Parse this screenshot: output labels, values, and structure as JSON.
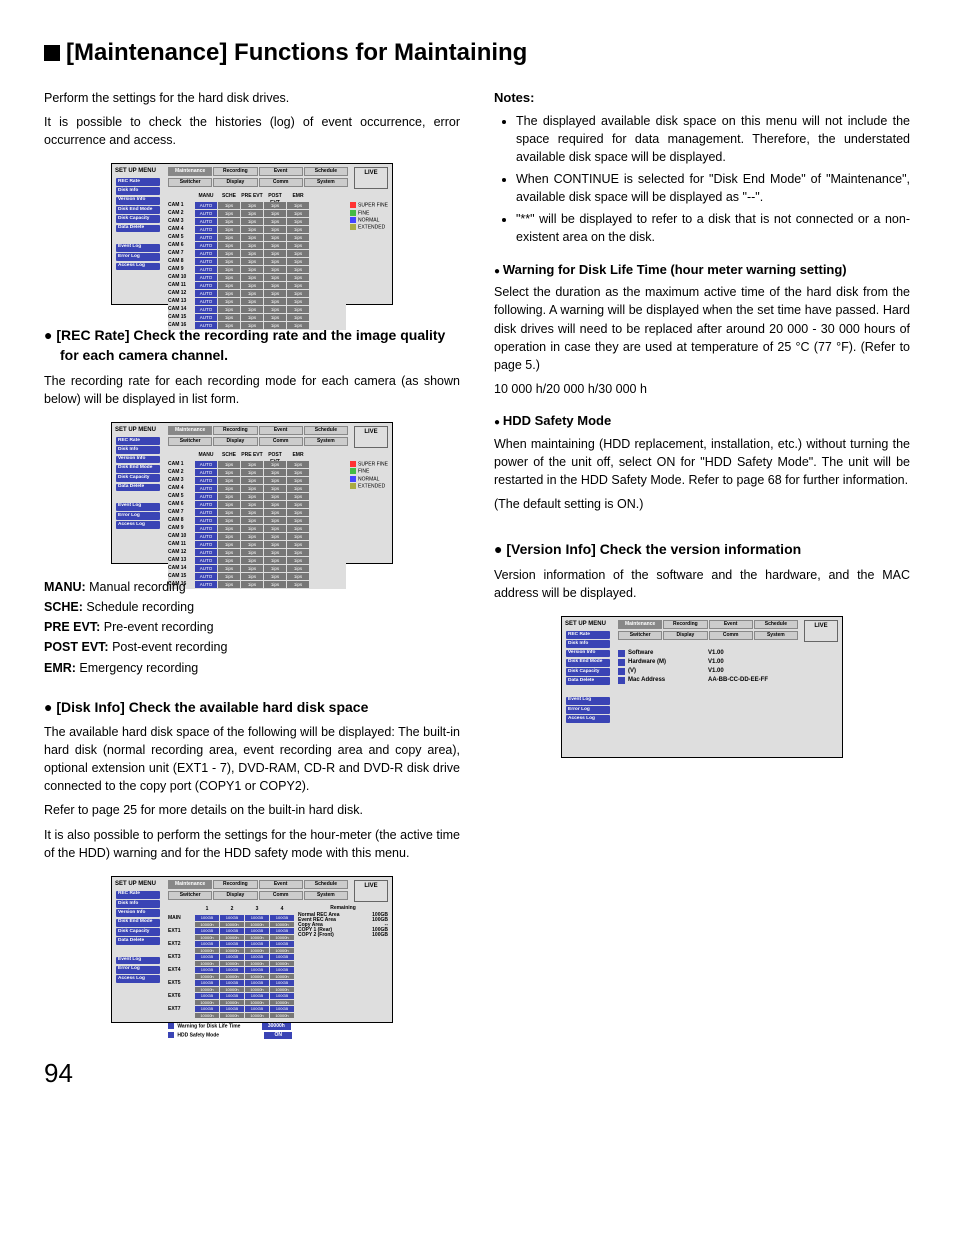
{
  "title_bracket": "[Maintenance]",
  "title_rest": " Functions for Maintaining",
  "intro_1": "Perform the settings for the hard disk drives.",
  "intro_2": "It is possible to check the histories (log) of event occurrence, error occurrence and access.",
  "rec_rate_h": "[REC Rate] Check the recording rate and the image quality for each camera channel.",
  "rec_rate_p": "The recording rate for each recording mode for each camera (as shown below) will be displayed in list form.",
  "defs": {
    "manu_l": "MANU:",
    "manu_v": " Manual recording",
    "sche_l": "SCHE:",
    "sche_v": " Schedule recording",
    "pre_l": "PRE EVT:",
    "pre_v": " Pre-event recording",
    "post_l": "POST EVT:",
    "post_v": " Post-event recording",
    "emr_l": "EMR:",
    "emr_v": " Emergency recording"
  },
  "disk_info_h": "[Disk Info] Check the available hard disk space",
  "disk_info_p1": "The available hard disk space of the following will be displayed: The built-in hard disk (normal recording area, event recording area and copy area), optional extension unit (EXT1 - 7), DVD-RAM, CD-R and DVD-R disk drive connected to the copy port (COPY1 or COPY2).",
  "disk_info_p2": "Refer to page 25 for more details on the built-in hard disk.",
  "disk_info_p3": "It is also possible to perform the settings for the hour-meter (the active time of the HDD) warning and for the HDD safety mode with this menu.",
  "notes_h": "Notes:",
  "notes": [
    "The displayed available disk space on this menu will not include the space required for data management. Therefore, the understated available disk space will be displayed.",
    "When CONTINUE is selected for \"Disk End Mode\" of \"Maintenance\", available disk space will be displayed as \"--\".",
    "\"**\" will be displayed to refer to a disk that is not connected or a non-existent area on the disk."
  ],
  "warn_h": "Warning for Disk Life Time (hour meter warning setting)",
  "warn_p1": "Select the duration as the maximum active time of the hard disk from the following. A warning will be displayed when the set time have passed. Hard disk drives will need to be replaced after around 20 000 - 30 000 hours of operation in case they are used at temperature of 25 °C (77 °F). (Refer to page 5.)",
  "warn_p2": "10 000 h/20 000 h/30 000 h",
  "hdd_h": "HDD Safety Mode",
  "hdd_p1": "When maintaining (HDD replacement, installation, etc.) without turning the power of the unit off, select ON for \"HDD Safety Mode\". The unit will be restarted in the HDD Safety Mode. Refer to page 68 for further information.",
  "hdd_p2": "(The default setting is ON.)",
  "ver_h": "[Version Info] Check the version information",
  "ver_p": "Version information of the software and the hardware, and the MAC address will be displayed.",
  "page_number": "94",
  "shots": {
    "sidebar_title": "SET UP MENU",
    "sidebar_items": [
      "REC Rate",
      "Disk Info",
      "Version Info",
      "Disk End Mode",
      "Disk Capacity",
      "Data Delete",
      "Event Log",
      "Error Log",
      "Access Log"
    ],
    "tabs_top": [
      "Maintenance",
      "Recording",
      "Event",
      "Schedule"
    ],
    "tabs_bottom": [
      "Switcher",
      "Display",
      "Comm",
      "System"
    ],
    "live": "LIVE",
    "rate_cols": [
      "MANU",
      "SCHE",
      "PRE EVT",
      "POST EVT",
      "EMR"
    ],
    "rate_rows": [
      "CAM 1",
      "CAM 2",
      "CAM 3",
      "CAM 4",
      "CAM 5",
      "CAM 6",
      "CAM 7",
      "CAM 8",
      "CAM 9",
      "CAM 10",
      "CAM 11",
      "CAM 12",
      "CAM 13",
      "CAM 14",
      "CAM 15",
      "CAM 16"
    ],
    "rate_val": "AUTO",
    "rate_ips": "1ips",
    "quality": [
      "SUPER FINE",
      "FINE",
      "NORMAL",
      "EXTENDED"
    ],
    "diskinfo_rows": [
      "MAIN",
      "EXT1",
      "EXT2",
      "EXT3",
      "EXT4",
      "EXT5",
      "EXT6",
      "EXT7"
    ],
    "diskinfo_cols": [
      "1",
      "2",
      "3",
      "4"
    ],
    "diskinfo_gb": "100GB",
    "diskinfo_h": "10000h",
    "remaining_h": "Remaining",
    "remaining": [
      {
        "k": "Normal REC Area",
        "v": "100GB"
      },
      {
        "k": "Event REC Area",
        "v": "100GB"
      },
      {
        "k": "Copy Area",
        "v": "--"
      },
      {
        "k": "COPY 1 (Rear)",
        "v": "100GB"
      },
      {
        "k": "COPY 2 (Front)",
        "v": "100GB"
      }
    ],
    "warn_life": "Warning for Disk Life Time",
    "warn_life_v": "30000h",
    "hdd_safety": "HDD Safety Mode",
    "hdd_safety_v": "ON",
    "ver_rows": [
      {
        "k": "Software",
        "v": "V1.00"
      },
      {
        "k": "Hardware (M)",
        "v": "V1.00"
      },
      {
        "k": "(V)",
        "v": "V1.00"
      },
      {
        "k": "Mac Address",
        "v": "AA-BB-CC-DD-EE-FF"
      }
    ]
  }
}
